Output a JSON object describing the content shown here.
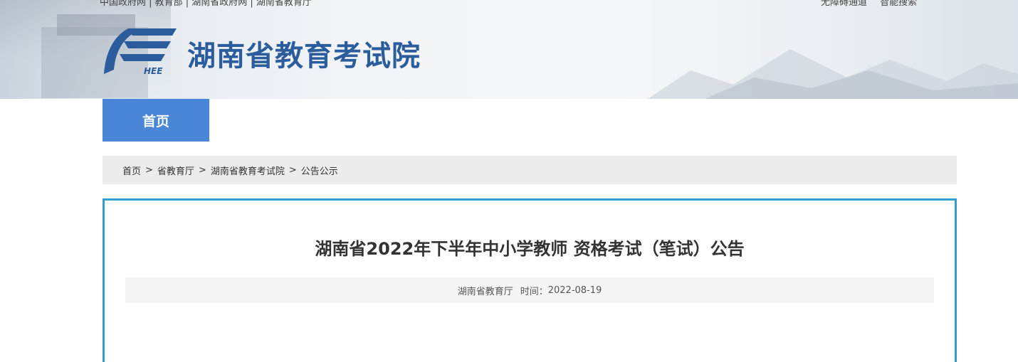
{
  "header": {
    "top_left_text": "中国政府网 | 教育部 | 湖南省政府网 | 湖南省教育厅",
    "top_right_links": [
      "无障碍通道",
      "智能搜索"
    ],
    "logo_text": "HEE",
    "site_title": "湖南省教育考试院"
  },
  "nav": {
    "home_label": "首页"
  },
  "breadcrumb": {
    "items": [
      "首页",
      "省教育厅",
      "湖南省教育考试院",
      "公告公示"
    ],
    "separator": ">"
  },
  "article": {
    "title": "湖南省2022年下半年中小学教师 资格考试（笔试）公告",
    "source": "湖南省教育厅",
    "time_label": "时间：",
    "date": "2022-08-19"
  },
  "colors": {
    "brand_blue": "#2b5c9b",
    "nav_blue": "#4a86d8",
    "card_border": "#2f9fd0"
  }
}
